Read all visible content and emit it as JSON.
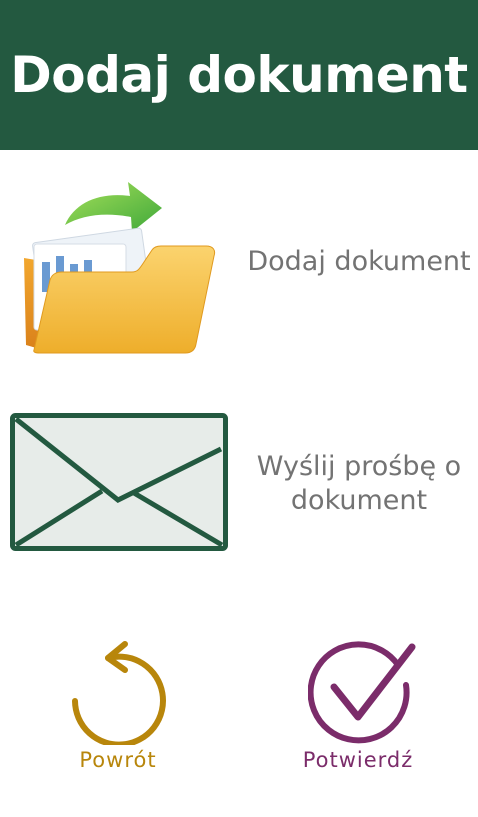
{
  "header": {
    "title": "Dodaj dokument"
  },
  "options": {
    "add_document": {
      "label": "Dodaj dokument",
      "icon": "open-folder-icon"
    },
    "request_document": {
      "label": "Wyślij prośbę o dokument",
      "icon": "envelope-icon"
    }
  },
  "actions": {
    "back": {
      "label": "Powrót",
      "icon": "undo-arrow-icon",
      "color": "#b8860b"
    },
    "confirm": {
      "label": "Potwierdź",
      "icon": "checkmark-icon",
      "color": "#7b2c6a"
    }
  },
  "colors": {
    "header_bg": "#235940",
    "header_text": "#ffffff",
    "label_text": "#737373"
  }
}
